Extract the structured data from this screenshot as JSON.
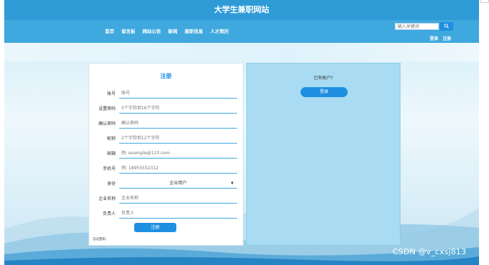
{
  "header": {
    "site_title": "大学生兼职网站",
    "nav": [
      "首页",
      "留言板",
      "网站公告",
      "新闻",
      "兼职信息",
      "人才简历"
    ],
    "search": {
      "placeholder": "输入关键词",
      "button_icon": "search-icon"
    },
    "auth": {
      "login": "登录",
      "register": "注册"
    }
  },
  "form": {
    "title": "注册",
    "fields": [
      {
        "label": "账号",
        "placeholder": "账号"
      },
      {
        "label": "设置密码",
        "placeholder": "5个字符到16个字符"
      },
      {
        "label": "确认密码",
        "placeholder": "确认密码"
      },
      {
        "label": "昵称",
        "placeholder": "2个字符到12个字符"
      },
      {
        "label": "邮箱",
        "placeholder": "例: example@123.com"
      },
      {
        "label": "手机号",
        "placeholder": "例: 18955552312"
      },
      {
        "label": "身份",
        "value": "企业用户",
        "type": "select"
      },
      {
        "label": "企业名称",
        "placeholder": "企业名称"
      },
      {
        "label": "负责人",
        "placeholder": "负责人"
      }
    ],
    "submit": "注册",
    "bottom_note": "忘记密码"
  },
  "side": {
    "question": "已有账户?",
    "login_button": "登录"
  },
  "watermark": "CSDN @v_cxsj813",
  "colors": {
    "primary": "#1f8fe2",
    "header": "#2e9bd6",
    "nav": "#3fa8de",
    "side_panel": "#a9dcf3"
  }
}
